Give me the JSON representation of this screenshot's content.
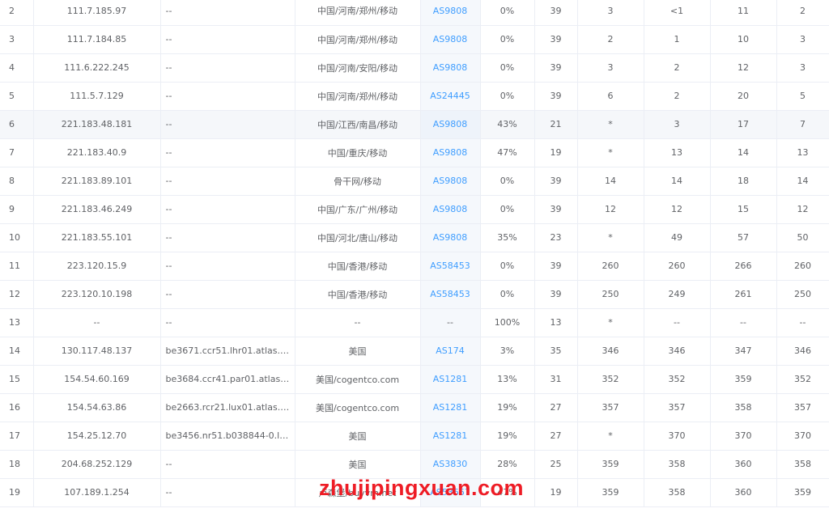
{
  "rows": [
    {
      "hop": "2",
      "ip": "111.7.185.97",
      "host": "--",
      "location": "中国/河南/郑州/移动",
      "asn": "AS9808",
      "loss": "0%",
      "sent": "39",
      "last": "3",
      "best": "<1",
      "avg": "11",
      "worst": "2"
    },
    {
      "hop": "3",
      "ip": "111.7.184.85",
      "host": "--",
      "location": "中国/河南/郑州/移动",
      "asn": "AS9808",
      "loss": "0%",
      "sent": "39",
      "last": "2",
      "best": "1",
      "avg": "10",
      "worst": "3"
    },
    {
      "hop": "4",
      "ip": "111.6.222.245",
      "host": "--",
      "location": "中国/河南/安阳/移动",
      "asn": "AS9808",
      "loss": "0%",
      "sent": "39",
      "last": "3",
      "best": "2",
      "avg": "12",
      "worst": "3"
    },
    {
      "hop": "5",
      "ip": "111.5.7.129",
      "host": "--",
      "location": "中国/河南/郑州/移动",
      "asn": "AS24445",
      "loss": "0%",
      "sent": "39",
      "last": "6",
      "best": "2",
      "avg": "20",
      "worst": "5"
    },
    {
      "hop": "6",
      "ip": "221.183.48.181",
      "host": "--",
      "location": "中国/江西/南昌/移动",
      "asn": "AS9808",
      "loss": "43%",
      "sent": "21",
      "last": "*",
      "best": "3",
      "avg": "17",
      "worst": "7"
    },
    {
      "hop": "7",
      "ip": "221.183.40.9",
      "host": "--",
      "location": "中国/重庆/移动",
      "asn": "AS9808",
      "loss": "47%",
      "sent": "19",
      "last": "*",
      "best": "13",
      "avg": "14",
      "worst": "13"
    },
    {
      "hop": "8",
      "ip": "221.183.89.101",
      "host": "--",
      "location": "骨干网/移动",
      "asn": "AS9808",
      "loss": "0%",
      "sent": "39",
      "last": "14",
      "best": "14",
      "avg": "18",
      "worst": "14"
    },
    {
      "hop": "9",
      "ip": "221.183.46.249",
      "host": "--",
      "location": "中国/广东/广州/移动",
      "asn": "AS9808",
      "loss": "0%",
      "sent": "39",
      "last": "12",
      "best": "12",
      "avg": "15",
      "worst": "12"
    },
    {
      "hop": "10",
      "ip": "221.183.55.101",
      "host": "--",
      "location": "中国/河北/唐山/移动",
      "asn": "AS9808",
      "loss": "35%",
      "sent": "23",
      "last": "*",
      "best": "49",
      "avg": "57",
      "worst": "50"
    },
    {
      "hop": "11",
      "ip": "223.120.15.9",
      "host": "--",
      "location": "中国/香港/移动",
      "asn": "AS58453",
      "loss": "0%",
      "sent": "39",
      "last": "260",
      "best": "260",
      "avg": "266",
      "worst": "260"
    },
    {
      "hop": "12",
      "ip": "223.120.10.198",
      "host": "--",
      "location": "中国/香港/移动",
      "asn": "AS58453",
      "loss": "0%",
      "sent": "39",
      "last": "250",
      "best": "249",
      "avg": "261",
      "worst": "250"
    },
    {
      "hop": "13",
      "ip": "--",
      "host": "--",
      "location": "--",
      "asn": "--",
      "loss": "100%",
      "sent": "13",
      "last": "*",
      "best": "--",
      "avg": "--",
      "worst": "--"
    },
    {
      "hop": "14",
      "ip": "130.117.48.137",
      "host": "be3671.ccr51.lhr01.atlas.cog...",
      "location": "美国",
      "asn": "AS174",
      "loss": "3%",
      "sent": "35",
      "last": "346",
      "best": "346",
      "avg": "347",
      "worst": "346"
    },
    {
      "hop": "15",
      "ip": "154.54.60.169",
      "host": "be3684.ccr41.par01.atlas.cog...",
      "location": "美国/cogentco.com",
      "asn": "AS1281",
      "loss": "13%",
      "sent": "31",
      "last": "352",
      "best": "352",
      "avg": "359",
      "worst": "352"
    },
    {
      "hop": "16",
      "ip": "154.54.63.86",
      "host": "be2663.rcr21.lux01.atlas.coge...",
      "location": "美国/cogentco.com",
      "asn": "AS1281",
      "loss": "19%",
      "sent": "27",
      "last": "357",
      "best": "357",
      "avg": "358",
      "worst": "357"
    },
    {
      "hop": "17",
      "ip": "154.25.12.70",
      "host": "be3456.nr51.b038844-0.lux0...",
      "location": "美国",
      "asn": "AS1281",
      "loss": "19%",
      "sent": "27",
      "last": "*",
      "best": "370",
      "avg": "370",
      "worst": "370"
    },
    {
      "hop": "18",
      "ip": "204.68.252.129",
      "host": "--",
      "location": "美国",
      "asn": "AS3830",
      "loss": "28%",
      "sent": "25",
      "last": "359",
      "best": "358",
      "avg": "360",
      "worst": "358"
    },
    {
      "hop": "19",
      "ip": "107.189.1.254",
      "host": "--",
      "location": "卢森堡/buyvm.net",
      "asn": "AS53667",
      "loss": "47%",
      "sent": "19",
      "last": "359",
      "best": "358",
      "avg": "360",
      "worst": "359"
    }
  ],
  "highlighted_hop": "6",
  "watermark": "zhujipingxuan.com",
  "colors": {
    "link": "#409eff",
    "text": "#606266",
    "border": "#ebeef5",
    "watermark": "#ee1c25"
  }
}
